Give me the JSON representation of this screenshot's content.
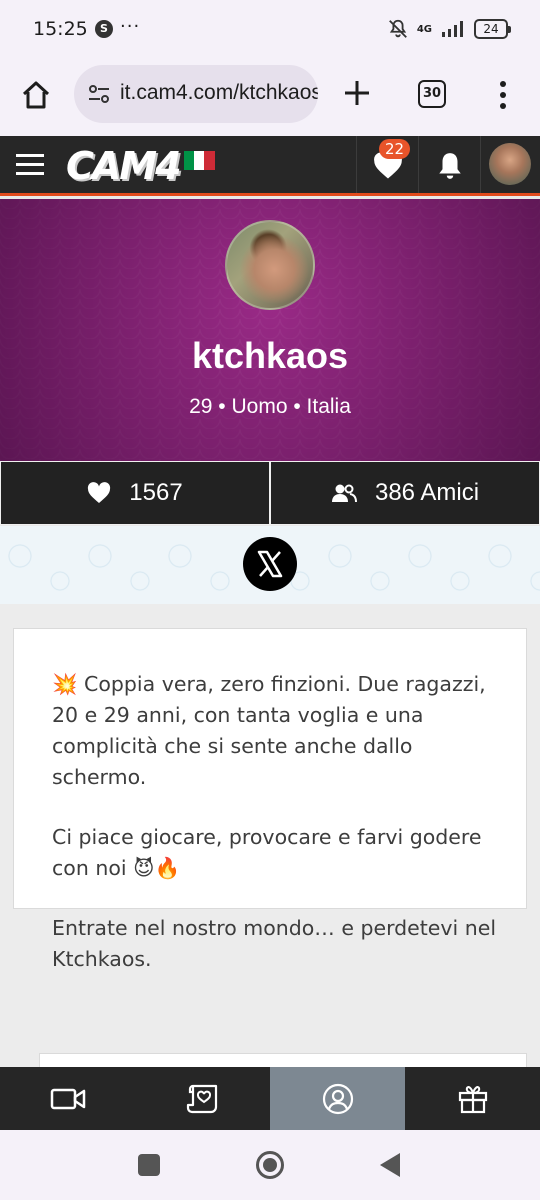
{
  "status_bar": {
    "time": "15:25",
    "app_icon_letter": "S",
    "more": "···",
    "network": "4G",
    "battery": "24"
  },
  "browser": {
    "url": "it.cam4.com/ktchkaos",
    "tab_count": "30"
  },
  "site_header": {
    "logo_text": "CAM4",
    "notification_count": "22",
    "flag_colors": [
      "#009246",
      "#ffffff",
      "#ce2b37"
    ]
  },
  "profile": {
    "username": "ktchkaos",
    "meta": "29 • Uomo • Italia",
    "likes": "1567",
    "friends": "386 Amici",
    "banner_color": "#9a2a87"
  },
  "bio": {
    "paragraph1": "💥 Coppia vera, zero finzioni. Due ragazzi, 20 e 29 anni, con tanta voglia e una complicità che si sente anche dallo schermo.",
    "paragraph2": "Ci piace giocare, provocare e farvi godere con noi 😈🔥",
    "paragraph3": "Entrate nel nostro mondo… e perdetevi nel Ktchkaos."
  },
  "bottom_nav": {
    "items": [
      {
        "icon": "video-camera-icon"
      },
      {
        "icon": "scroll-heart-icon"
      },
      {
        "icon": "user-profile-icon",
        "active": true
      },
      {
        "icon": "gift-icon"
      }
    ]
  }
}
